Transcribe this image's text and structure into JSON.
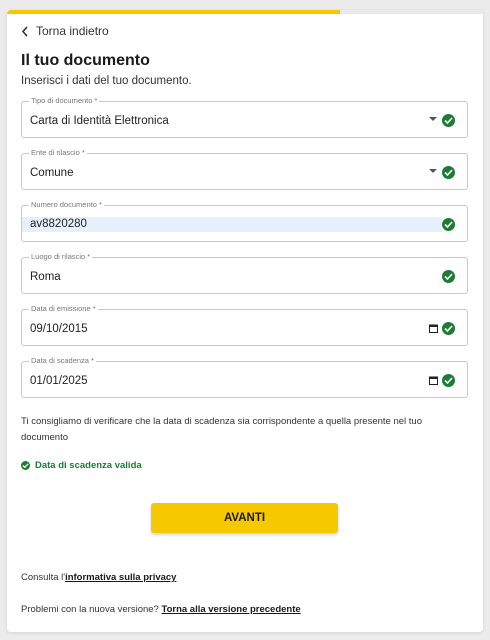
{
  "progress": {
    "fraction": 0.7
  },
  "back": {
    "label": "Torna indietro"
  },
  "header": {
    "title": "Il tuo documento",
    "subtitle": "Inserisci i dati del tuo documento."
  },
  "fields": [
    {
      "label": "Tipo di documento *",
      "value": "Carta di Identità Elettronica",
      "kind": "select",
      "valid": true
    },
    {
      "label": "Ente di rilascio *",
      "value": "Comune",
      "kind": "select",
      "valid": true
    },
    {
      "label": "Numero documento *",
      "value": "av8820280",
      "kind": "text",
      "valid": true
    },
    {
      "label": "Luogo di rilascio *",
      "value": "Roma",
      "kind": "text",
      "valid": true
    },
    {
      "label": "Data di emissione *",
      "value": "09/10/2015",
      "kind": "date",
      "valid": true
    },
    {
      "label": "Data di scadenza *",
      "value": "01/01/2025",
      "kind": "date",
      "valid": true
    }
  ],
  "note": "Ti consigliamo di verificare che la data di scadenza sia corrispondente a quella presente nel tuo documento",
  "validation": {
    "text": "Data di scadenza valida"
  },
  "primary_button": {
    "label": "AVANTI"
  },
  "footer": {
    "privacy_prefix": "Consulta l'",
    "privacy_link": "informativa sulla privacy",
    "problems_prefix": "Problemi con la nuova versione? ",
    "problems_link": "Torna alla versione precedente"
  },
  "colors": {
    "accent": "#f6c800",
    "success": "#1e7b34",
    "border": "#c8c8c8"
  },
  "icons": {
    "back": "chevron-left-icon",
    "valid": "check-circle-icon",
    "select": "caret-down-icon",
    "date": "calendar-icon"
  }
}
